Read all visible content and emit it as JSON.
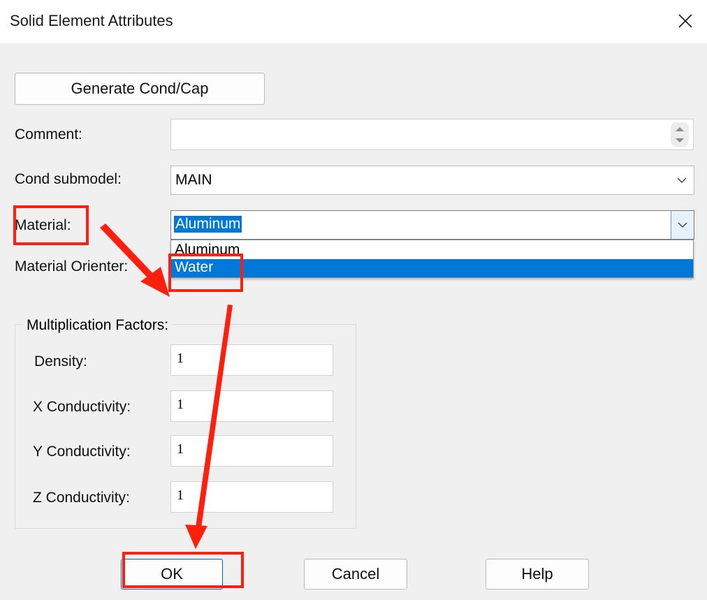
{
  "dialog": {
    "title": "Solid Element Attributes"
  },
  "buttons": {
    "generate": "Generate Cond/Cap",
    "ok": "OK",
    "cancel": "Cancel",
    "help": "Help"
  },
  "form": {
    "comment_label": "Comment:",
    "comment_value": "",
    "cond_submodel_label": "Cond submodel:",
    "cond_submodel_value": "MAIN",
    "material_label": "Material:",
    "material_value": "Aluminum",
    "material_options": [
      "Aluminum",
      "Water"
    ],
    "material_highlighted_option": "Water",
    "material_orienter_label": "Material Orienter:"
  },
  "multiplication_factors": {
    "legend": "Multiplication Factors:",
    "density_label": "Density:",
    "density_value": "1",
    "x_conductivity_label": "X Conductivity:",
    "x_conductivity_value": "1",
    "y_conductivity_label": "Y Conductivity:",
    "y_conductivity_value": "1",
    "z_conductivity_label": "Z Conductivity:",
    "z_conductivity_value": "1"
  },
  "colors": {
    "selection": "#0078d7",
    "annotation": "#ff1f0f",
    "background": "#f0f0f0"
  }
}
